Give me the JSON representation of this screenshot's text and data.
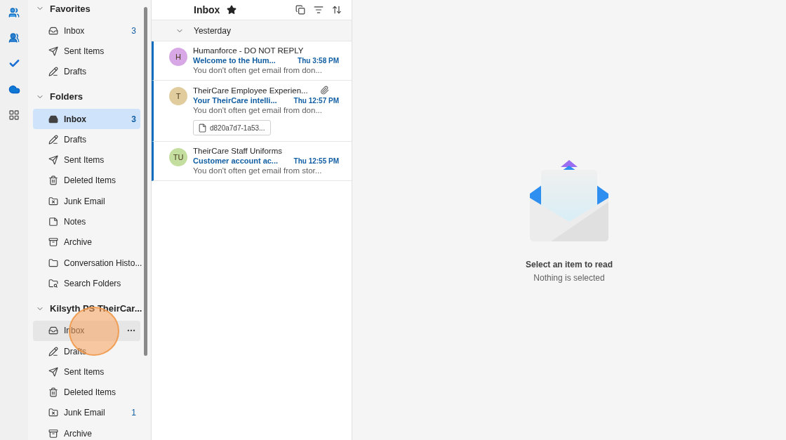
{
  "folder_groups": [
    {
      "title": "Favorites",
      "expanded": true,
      "items": [
        {
          "label": "Inbox",
          "kind": "inbox",
          "count": "3",
          "selected": false,
          "hovered": false
        },
        {
          "label": "Sent Items",
          "kind": "sent",
          "selected": false,
          "hovered": false
        },
        {
          "label": "Drafts",
          "kind": "drafts",
          "selected": false,
          "hovered": false
        }
      ]
    },
    {
      "title": "Folders",
      "expanded": true,
      "items": [
        {
          "label": "Inbox",
          "kind": "inbox",
          "count": "3",
          "selected": true,
          "hovered": false
        },
        {
          "label": "Drafts",
          "kind": "drafts",
          "selected": false,
          "hovered": false
        },
        {
          "label": "Sent Items",
          "kind": "sent",
          "selected": false,
          "hovered": false
        },
        {
          "label": "Deleted Items",
          "kind": "deleted",
          "selected": false,
          "hovered": false
        },
        {
          "label": "Junk Email",
          "kind": "junk",
          "selected": false,
          "hovered": false
        },
        {
          "label": "Notes",
          "kind": "notes",
          "selected": false,
          "hovered": false
        },
        {
          "label": "Archive",
          "kind": "archive",
          "selected": false,
          "hovered": false
        },
        {
          "label": "Conversation Histo...",
          "kind": "folder",
          "selected": false,
          "hovered": false
        },
        {
          "label": "Search Folders",
          "kind": "search",
          "selected": false,
          "hovered": false
        }
      ]
    },
    {
      "title": "Kilsyth PS TheirCar...",
      "expanded": true,
      "items": [
        {
          "label": "Inbox",
          "kind": "inbox",
          "selected": false,
          "hovered": true
        },
        {
          "label": "Drafts",
          "kind": "drafts",
          "selected": false,
          "hovered": false
        },
        {
          "label": "Sent Items",
          "kind": "sent",
          "selected": false,
          "hovered": false
        },
        {
          "label": "Deleted Items",
          "kind": "deleted",
          "selected": false,
          "hovered": false
        },
        {
          "label": "Junk Email",
          "kind": "junk",
          "count": "1",
          "selected": false,
          "hovered": false
        },
        {
          "label": "Archive",
          "kind": "archive",
          "selected": false,
          "hovered": false
        }
      ]
    }
  ],
  "list": {
    "title": "Inbox",
    "favorite": true,
    "group": {
      "label": "Yesterday",
      "expanded": true
    },
    "messages": [
      {
        "initials": "H",
        "color": "#d8a8e6",
        "sender": "Humanforce - DO NOT REPLY",
        "subject": "Welcome to the Hum...",
        "time": "Thu 3:58 PM",
        "preview": "You don't often get email from don...",
        "unread": true,
        "attachment": false
      },
      {
        "initials": "T",
        "color": "#e0cc9c",
        "sender": "TheirCare Employee Experien...",
        "subject": "Your TheirCare intelli...",
        "time": "Thu 12:57 PM",
        "preview": "You don't often get email from don...",
        "unread": true,
        "attachment": true,
        "attachment_name": "d820a7d7-1a53..."
      },
      {
        "initials": "TU",
        "color": "#c4dea0",
        "sender": "TheirCare Staff Uniforms",
        "subject": "Customer account ac...",
        "time": "Thu 12:55 PM",
        "preview": "You don't often get email from stor...",
        "unread": true,
        "attachment": false
      }
    ]
  },
  "reading_pane": {
    "title": "Select an item to read",
    "subtitle": "Nothing is selected"
  },
  "click_marker": true
}
